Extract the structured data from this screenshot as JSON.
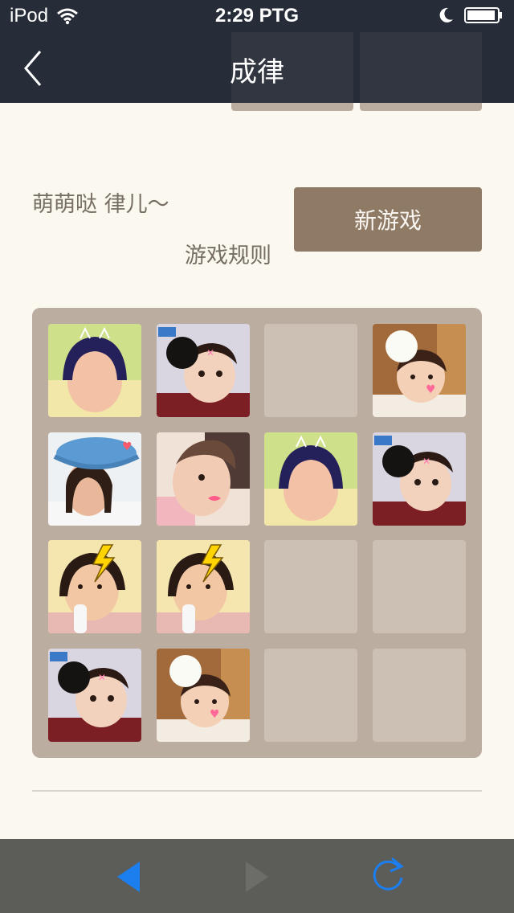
{
  "status": {
    "carrier": "iPod",
    "time": "2:29 PTG"
  },
  "nav": {
    "title": "成律",
    "back_label": ""
  },
  "intro": {
    "tagline": "萌萌哒 律儿～",
    "rules_link": "游戏规则",
    "new_game_label": "新游戏"
  },
  "board": {
    "rows": [
      [
        "girl-cat-ears",
        "baby-black-bow",
        "empty",
        "baby-white-flower"
      ],
      [
        "girl-blue-hat",
        "toddler-kiss",
        "girl-cat-ears",
        "baby-black-bow"
      ],
      [
        "girl-lightning-bottle",
        "girl-lightning-bottle",
        "empty",
        "empty"
      ],
      [
        "baby-black-bow",
        "baby-white-flower",
        "empty",
        "empty"
      ]
    ]
  },
  "toolbar": {
    "items": [
      "back-arrow-icon",
      "forward-arrow-icon",
      "refresh-icon"
    ],
    "accent": "#1b7ff0"
  },
  "colors": {
    "background": "#faf8ef",
    "nav": "#262c38",
    "board": "#bbada0",
    "button": "#8f7a66",
    "text": "#776e65"
  }
}
